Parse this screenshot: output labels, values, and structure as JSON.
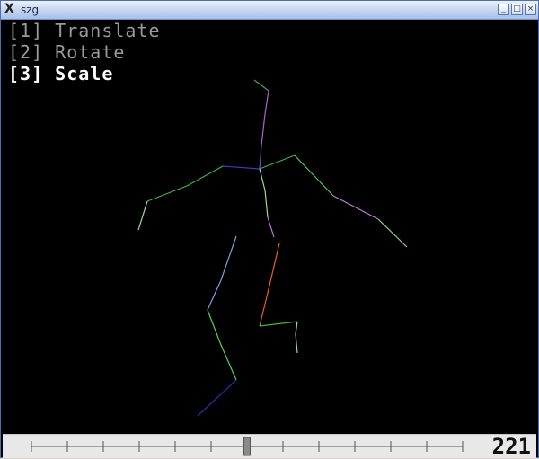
{
  "window": {
    "title": "szg",
    "app_icon": "x-icon"
  },
  "menu": [
    {
      "key": "[1]",
      "label": "Translate",
      "active": false
    },
    {
      "key": "[2]",
      "label": "Rotate",
      "active": false
    },
    {
      "key": "[3]",
      "label": "Scale",
      "active": true
    }
  ],
  "frame_counter": "221",
  "slider": {
    "ticks": 13,
    "handle_position": 0.5
  }
}
